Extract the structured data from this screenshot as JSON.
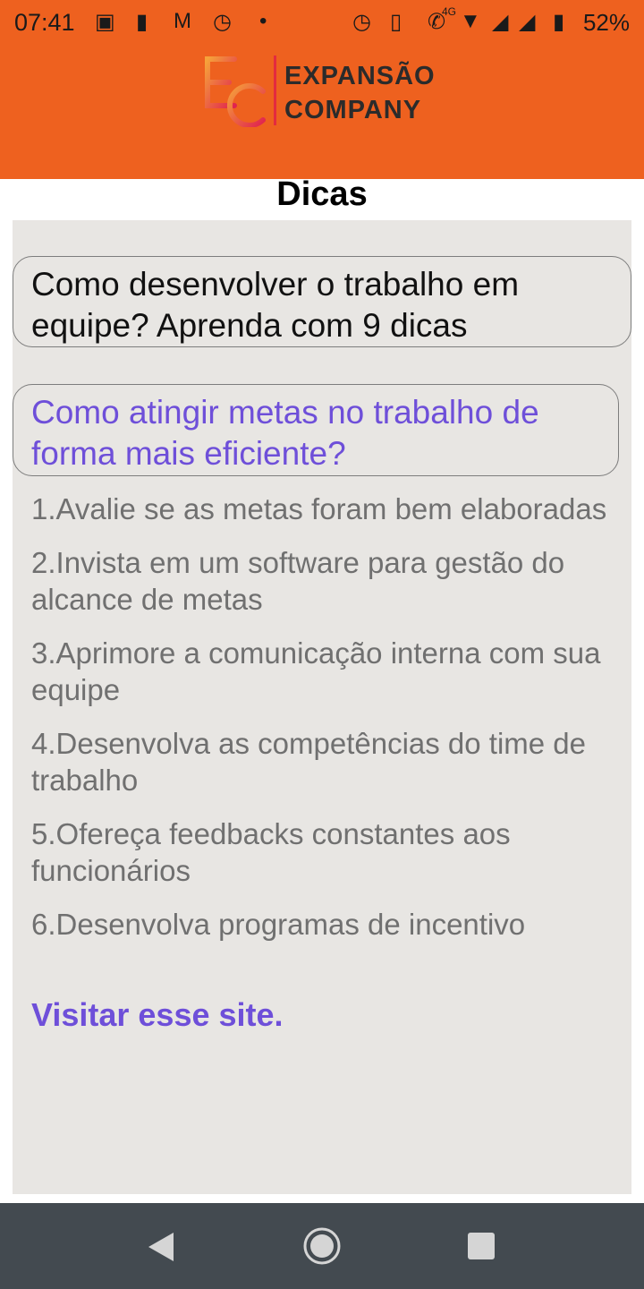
{
  "status_bar": {
    "time": "07:41",
    "network": "4G",
    "battery": "52%",
    "icons": [
      "image-icon",
      "trash-icon",
      "gmail-icon",
      "alarm-icon",
      "dot-icon",
      "alarm-icon",
      "vibrate-icon",
      "wifi-call-icon",
      "wifi-icon",
      "signal-icon",
      "battery-icon"
    ]
  },
  "header": {
    "brand_line1": "EXPANSÃO",
    "brand_line2": "COMPANY",
    "bar_color": "#ee611f"
  },
  "page": {
    "title": "Dicas"
  },
  "cards": [
    {
      "text": "Como desenvolver o trabalho em equipe? Aprenda com 9 dicas"
    },
    {
      "text": "Como atingir metas no trabalho de forma mais eficiente?"
    }
  ],
  "tips": [
    "1.Avalie se as metas foram bem elaboradas",
    "2.Invista em um software para gestão do alcance de metas",
    "3.Aprimore a comunicação interna com sua equipe",
    "4.Desenvolva as competências do time de trabalho",
    "5.Ofereça feedbacks constantes aos funcionários",
    "6.Desenvolva programas de incentivo"
  ],
  "link": {
    "label": "Visitar esse site.",
    "color": "#6e4fd9"
  },
  "nav": {
    "icons": [
      "back-icon",
      "home-icon",
      "recent-apps-icon"
    ]
  }
}
